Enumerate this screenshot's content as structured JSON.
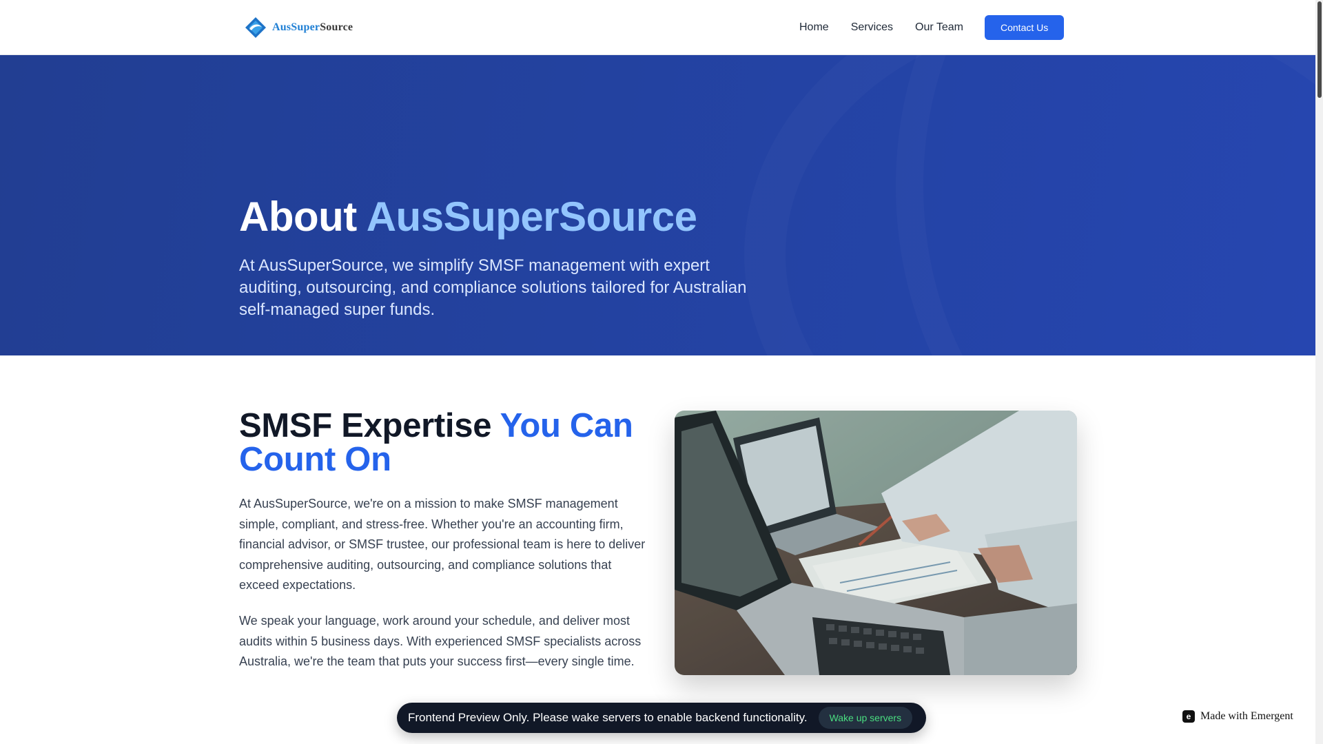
{
  "header": {
    "logo_text_a": "AusSuper",
    "logo_text_b": "Source",
    "logo_icon": "logo-mark-icon",
    "nav": [
      {
        "label": "Home"
      },
      {
        "label": "Services"
      },
      {
        "label": "Our Team"
      }
    ],
    "contact_label": "Contact Us"
  },
  "hero": {
    "title_plain": "About ",
    "title_accent": "AusSuperSource",
    "subtitle": "At AusSuperSource, we simplify SMSF management with expert auditing, outsourcing, and compliance solutions tailored for Australian self-managed super funds."
  },
  "about": {
    "title_plain": "SMSF Expertise ",
    "title_accent": "You Can Count On",
    "paragraph_1": "At AusSuperSource, we're on a mission to make SMSF management simple, compliant, and stress-free. Whether you're an accounting firm, financial advisor, or SMSF trustee, our professional team is here to deliver comprehensive auditing, outsourcing, and compliance solutions that exceed expectations.",
    "paragraph_2": "We speak your language, work around your schedule, and deliver most audits within 5 business days. With experienced SMSF specialists across Australia, we're the team that puts your success first—every single time.",
    "photo_icon": "laptop-meeting-photo"
  },
  "toast": {
    "message": "Frontend Preview Only. Please wake servers to enable backend functionality.",
    "button_label": "Wake up servers"
  },
  "badge": {
    "label": "Made with Emergent",
    "icon": "emergent-logo-icon"
  },
  "colors": {
    "brand_blue": "#2563eb",
    "hero_bg": "#2342a0",
    "hero_accent": "#93c5fd",
    "toast_bg": "#111827",
    "toast_button_text": "#4ade80"
  }
}
